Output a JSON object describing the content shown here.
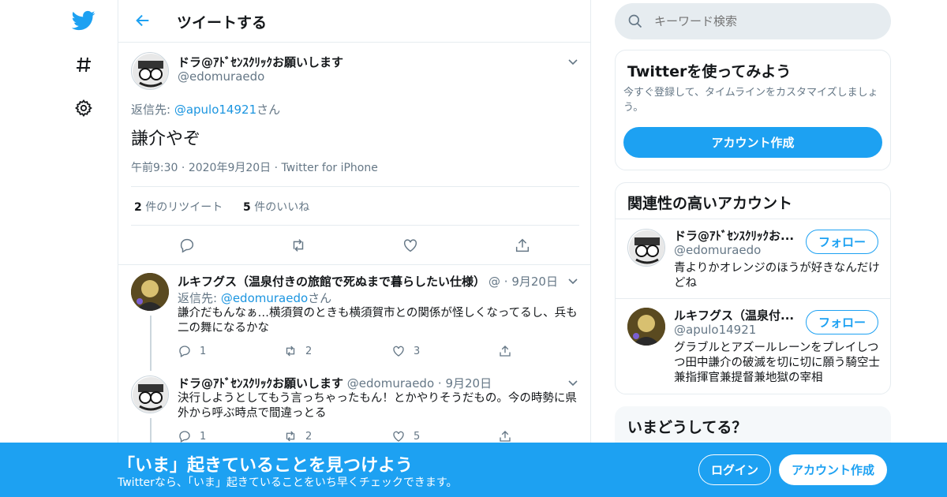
{
  "header": {
    "title": "ツイートする"
  },
  "search": {
    "placeholder": "キーワード検索"
  },
  "main_tweet": {
    "author": "ドラ@ｱﾄﾞｾﾝｽｸﾘｯｸお願いします",
    "handle": "@edomuraedo",
    "reply_prefix": "返信先: ",
    "reply_to": "@apulo14921",
    "reply_suffix": "さん",
    "text": "謙介やぞ",
    "time": "午前9:30",
    "date": "2020年9月20日",
    "source": "Twitter for iPhone",
    "retweet_count": "2",
    "retweet_label": "件のリツイート",
    "like_count": "5",
    "like_label": "件のいいね"
  },
  "replies": [
    {
      "author": "ルキフグス（温泉付きの旅館で死ぬまで暮らしたい仕様）",
      "handle": "@",
      "date": "9月20日",
      "reply_prefix": "返信先: ",
      "reply_to": "@edomuraedo",
      "reply_suffix": "さん",
      "text": "謙介だもんなぁ…横須賀のときも横須賀市との関係が怪しくなってるし、兵も二の舞になるかな",
      "replies": "1",
      "retweets": "2",
      "likes": "3"
    },
    {
      "author": "ドラ@ｱﾄﾞｾﾝｽｸﾘｯｸお願いします",
      "handle": "@edomuraedo",
      "date": "9月20日",
      "text": "決行しようとしてもう言っちゃったもん！とかやりそうだもの。今の時勢に県外から呼ぶ時点で間違っとる",
      "replies": "1",
      "retweets": "2",
      "likes": "5"
    }
  ],
  "signup_card": {
    "title": "Twitterを使ってみよう",
    "desc": "今すぐ登録して、タイムラインをカスタマイズしましょう。",
    "button": "アカウント作成"
  },
  "related": {
    "title": "関連性の高いアカウント",
    "follow_label": "フォロー",
    "accounts": [
      {
        "name": "ドラ@ｱﾄﾞｾﾝｽｸﾘｯｸお...",
        "handle": "@edomuraedo",
        "bio": "青よりかオレンジのほうが好きなんだけどね"
      },
      {
        "name": "ルキフグス（温泉付...",
        "handle": "@apulo14921",
        "bio": "グラブルとアズールレーンをプレイしつつ田中謙介の破滅を切に切に願う騎空士兼指揮官兼提督兼地獄の宰相"
      }
    ]
  },
  "trends": {
    "title": "いまどうしてる？"
  },
  "banner": {
    "title": "「いま」起きていることを見つけよう",
    "subtitle": "Twitterなら、「いま」起きていることをいち早くチェックできます。",
    "login": "ログイン",
    "signup": "アカウント作成"
  },
  "colors": {
    "accent": "#1da1f2",
    "text": "#14171a",
    "muted": "#657786"
  }
}
